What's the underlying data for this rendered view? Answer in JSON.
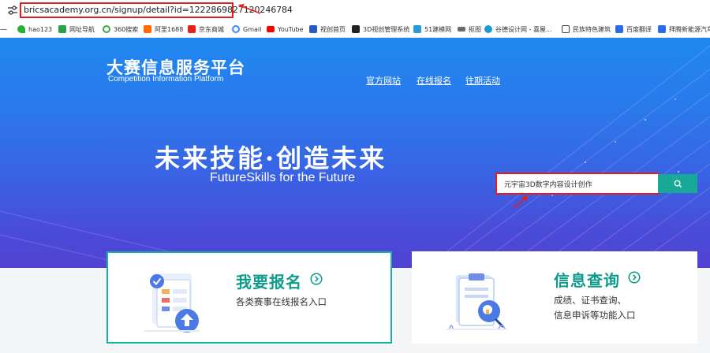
{
  "browser": {
    "url": "bricsacademy.org.cn/signup/detail?id=1222869827120246784",
    "bookmarks": [
      {
        "label": "",
        "icon": "chevron-icon",
        "color": "#555555"
      },
      {
        "label": "hao123",
        "icon": "hao123-icon",
        "color": "#2cae3c"
      },
      {
        "label": "网址导航",
        "icon": "nav-site-icon",
        "color": "#27a34a"
      },
      {
        "label": "360搜索",
        "icon": "360-search-icon",
        "color": "#3fa34d"
      },
      {
        "label": "阿里1688",
        "icon": "alibaba-icon",
        "color": "#ff6a00"
      },
      {
        "label": "京东商城",
        "icon": "jd-icon",
        "color": "#e1251b"
      },
      {
        "label": "Gmail",
        "icon": "google-icon",
        "color": "#4285f4"
      },
      {
        "label": "YouTube",
        "icon": "youtube-icon",
        "color": "#ff0000"
      },
      {
        "label": "视创首页",
        "icon": "shichuang-icon",
        "color": "#2b59c3"
      },
      {
        "label": "3D视创管理系统",
        "icon": "3d-system-icon",
        "color": "#222222"
      },
      {
        "label": "51建模网",
        "icon": "51jianmo-icon",
        "color": "#2a9ad6"
      },
      {
        "label": "抠图",
        "icon": "cutout-icon",
        "color": "#6a6a6a"
      },
      {
        "label": "谷德设计网 - 喜屋...",
        "icon": "gooood-icon",
        "color": "#1a9bd7"
      },
      {
        "label": "民族特色建筑",
        "icon": "folder-icon",
        "color": "#444444"
      },
      {
        "label": "百度翻译",
        "icon": "baidu-translate-icon",
        "color": "#2b6de8"
      },
      {
        "label": "拜腾新能源汽车",
        "icon": "byton-icon",
        "color": "#2b6de8"
      }
    ]
  },
  "site": {
    "brand_cn": "大赛信息服务平台",
    "brand_en": "Competition Information Platform",
    "nav": [
      "官方网站",
      "在线报名",
      "往期活动"
    ],
    "slogan_cn": "未来技能·创造未来",
    "slogan_en": "FutureSkills  for the Future",
    "search": {
      "value": "元宇宙3D数字内容设计创作",
      "button_icon": "search-icon"
    }
  },
  "cards": [
    {
      "title": "我要报名",
      "desc": [
        "各类赛事在线报名入口"
      ],
      "icon": "signup-form-icon"
    },
    {
      "title": "信息查询",
      "desc": [
        "成绩、证书查询、",
        "信息申诉等功能入口"
      ],
      "icon": "clipboard-search-icon"
    }
  ],
  "colors": {
    "accent_teal": "#13b4a4",
    "hero_top": "#1f88f0",
    "hero_bottom": "#5242d3",
    "annotation_red": "#e02020"
  }
}
